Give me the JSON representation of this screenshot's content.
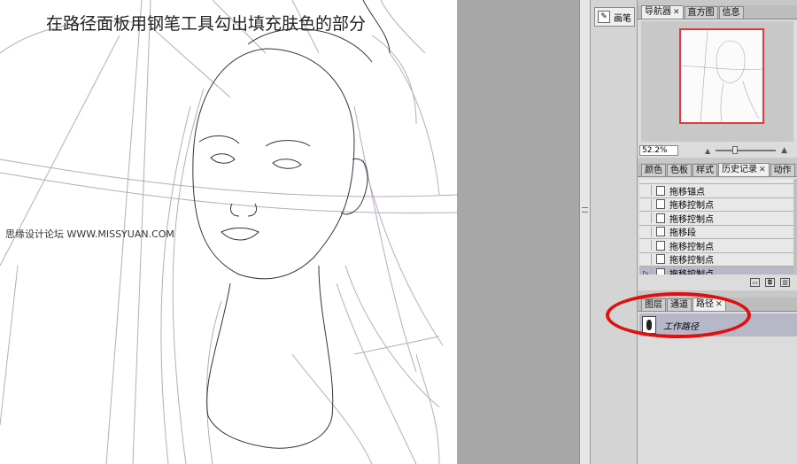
{
  "caption": "在路径面板用钢笔工具勾出填充肤色的部分",
  "watermark": "思缘设计论坛 WWW.MISSYUAN.COM",
  "dock": {
    "brush_label": "画笔",
    "brush_icon": "brush-icon"
  },
  "navigator_panel": {
    "tabs": [
      {
        "label": "导航器",
        "active": true,
        "closable": true
      },
      {
        "label": "直方图",
        "active": false,
        "closable": false
      },
      {
        "label": "信息",
        "active": false,
        "closable": false
      }
    ],
    "zoom_value": "52.2%",
    "zoom_fraction": 0.3,
    "view_box_color": "#e23a3a"
  },
  "history_panel": {
    "tabs": [
      {
        "label": "颜色",
        "active": false,
        "closable": false
      },
      {
        "label": "色板",
        "active": false,
        "closable": false
      },
      {
        "label": "样式",
        "active": false,
        "closable": false
      },
      {
        "label": "历史记录",
        "active": true,
        "closable": true
      },
      {
        "label": "动作",
        "active": false,
        "closable": false
      }
    ],
    "items": [
      {
        "label": "拖移锚点",
        "selected": false
      },
      {
        "label": "拖移控制点",
        "selected": false
      },
      {
        "label": "拖移控制点",
        "selected": false
      },
      {
        "label": "拖移段",
        "selected": false
      },
      {
        "label": "拖移控制点",
        "selected": false
      },
      {
        "label": "拖移控制点",
        "selected": false
      },
      {
        "label": "拖移控制点",
        "selected": true
      }
    ]
  },
  "paths_panel": {
    "tabs": [
      {
        "label": "图层",
        "active": false,
        "closable": false
      },
      {
        "label": "通道",
        "active": false,
        "closable": false
      },
      {
        "label": "路径",
        "active": true,
        "closable": true
      }
    ],
    "path_item": "工作路径",
    "highlight_color": "#e01010"
  }
}
